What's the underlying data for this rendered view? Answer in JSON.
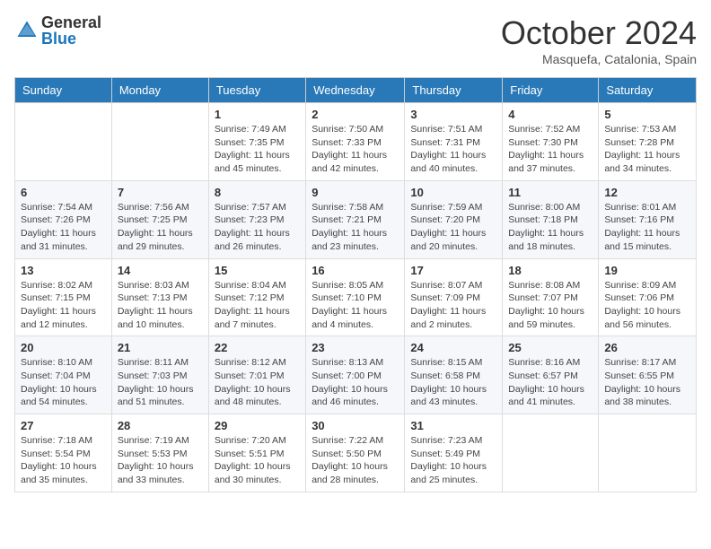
{
  "header": {
    "logo": {
      "general": "General",
      "blue": "Blue"
    },
    "title": "October 2024",
    "location": "Masquefa, Catalonia, Spain"
  },
  "weekdays": [
    "Sunday",
    "Monday",
    "Tuesday",
    "Wednesday",
    "Thursday",
    "Friday",
    "Saturday"
  ],
  "weeks": [
    [
      {
        "day": "",
        "info": ""
      },
      {
        "day": "",
        "info": ""
      },
      {
        "day": "1",
        "info": "Sunrise: 7:49 AM\nSunset: 7:35 PM\nDaylight: 11 hours and 45 minutes."
      },
      {
        "day": "2",
        "info": "Sunrise: 7:50 AM\nSunset: 7:33 PM\nDaylight: 11 hours and 42 minutes."
      },
      {
        "day": "3",
        "info": "Sunrise: 7:51 AM\nSunset: 7:31 PM\nDaylight: 11 hours and 40 minutes."
      },
      {
        "day": "4",
        "info": "Sunrise: 7:52 AM\nSunset: 7:30 PM\nDaylight: 11 hours and 37 minutes."
      },
      {
        "day": "5",
        "info": "Sunrise: 7:53 AM\nSunset: 7:28 PM\nDaylight: 11 hours and 34 minutes."
      }
    ],
    [
      {
        "day": "6",
        "info": "Sunrise: 7:54 AM\nSunset: 7:26 PM\nDaylight: 11 hours and 31 minutes."
      },
      {
        "day": "7",
        "info": "Sunrise: 7:56 AM\nSunset: 7:25 PM\nDaylight: 11 hours and 29 minutes."
      },
      {
        "day": "8",
        "info": "Sunrise: 7:57 AM\nSunset: 7:23 PM\nDaylight: 11 hours and 26 minutes."
      },
      {
        "day": "9",
        "info": "Sunrise: 7:58 AM\nSunset: 7:21 PM\nDaylight: 11 hours and 23 minutes."
      },
      {
        "day": "10",
        "info": "Sunrise: 7:59 AM\nSunset: 7:20 PM\nDaylight: 11 hours and 20 minutes."
      },
      {
        "day": "11",
        "info": "Sunrise: 8:00 AM\nSunset: 7:18 PM\nDaylight: 11 hours and 18 minutes."
      },
      {
        "day": "12",
        "info": "Sunrise: 8:01 AM\nSunset: 7:16 PM\nDaylight: 11 hours and 15 minutes."
      }
    ],
    [
      {
        "day": "13",
        "info": "Sunrise: 8:02 AM\nSunset: 7:15 PM\nDaylight: 11 hours and 12 minutes."
      },
      {
        "day": "14",
        "info": "Sunrise: 8:03 AM\nSunset: 7:13 PM\nDaylight: 11 hours and 10 minutes."
      },
      {
        "day": "15",
        "info": "Sunrise: 8:04 AM\nSunset: 7:12 PM\nDaylight: 11 hours and 7 minutes."
      },
      {
        "day": "16",
        "info": "Sunrise: 8:05 AM\nSunset: 7:10 PM\nDaylight: 11 hours and 4 minutes."
      },
      {
        "day": "17",
        "info": "Sunrise: 8:07 AM\nSunset: 7:09 PM\nDaylight: 11 hours and 2 minutes."
      },
      {
        "day": "18",
        "info": "Sunrise: 8:08 AM\nSunset: 7:07 PM\nDaylight: 10 hours and 59 minutes."
      },
      {
        "day": "19",
        "info": "Sunrise: 8:09 AM\nSunset: 7:06 PM\nDaylight: 10 hours and 56 minutes."
      }
    ],
    [
      {
        "day": "20",
        "info": "Sunrise: 8:10 AM\nSunset: 7:04 PM\nDaylight: 10 hours and 54 minutes."
      },
      {
        "day": "21",
        "info": "Sunrise: 8:11 AM\nSunset: 7:03 PM\nDaylight: 10 hours and 51 minutes."
      },
      {
        "day": "22",
        "info": "Sunrise: 8:12 AM\nSunset: 7:01 PM\nDaylight: 10 hours and 48 minutes."
      },
      {
        "day": "23",
        "info": "Sunrise: 8:13 AM\nSunset: 7:00 PM\nDaylight: 10 hours and 46 minutes."
      },
      {
        "day": "24",
        "info": "Sunrise: 8:15 AM\nSunset: 6:58 PM\nDaylight: 10 hours and 43 minutes."
      },
      {
        "day": "25",
        "info": "Sunrise: 8:16 AM\nSunset: 6:57 PM\nDaylight: 10 hours and 41 minutes."
      },
      {
        "day": "26",
        "info": "Sunrise: 8:17 AM\nSunset: 6:55 PM\nDaylight: 10 hours and 38 minutes."
      }
    ],
    [
      {
        "day": "27",
        "info": "Sunrise: 7:18 AM\nSunset: 5:54 PM\nDaylight: 10 hours and 35 minutes."
      },
      {
        "day": "28",
        "info": "Sunrise: 7:19 AM\nSunset: 5:53 PM\nDaylight: 10 hours and 33 minutes."
      },
      {
        "day": "29",
        "info": "Sunrise: 7:20 AM\nSunset: 5:51 PM\nDaylight: 10 hours and 30 minutes."
      },
      {
        "day": "30",
        "info": "Sunrise: 7:22 AM\nSunset: 5:50 PM\nDaylight: 10 hours and 28 minutes."
      },
      {
        "day": "31",
        "info": "Sunrise: 7:23 AM\nSunset: 5:49 PM\nDaylight: 10 hours and 25 minutes."
      },
      {
        "day": "",
        "info": ""
      },
      {
        "day": "",
        "info": ""
      }
    ]
  ]
}
